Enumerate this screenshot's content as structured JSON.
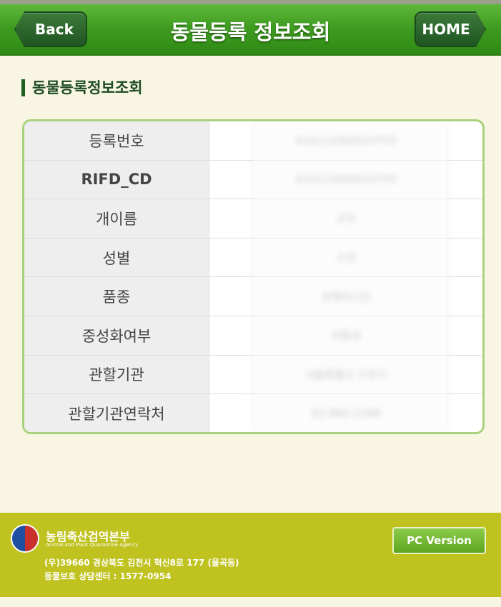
{
  "header": {
    "title": "동물등록 정보조회",
    "back_label": "Back",
    "home_label": "HOME"
  },
  "section": {
    "title": "동물등록정보조회"
  },
  "info_rows": [
    {
      "label": "등록번호",
      "value": "410111000010755"
    },
    {
      "label": "RIFD_CD",
      "value": "410111000010755"
    },
    {
      "label": "개이름",
      "value": "코코"
    },
    {
      "label": "성별",
      "value": "수컷"
    },
    {
      "label": "품종",
      "value": "포메라니안"
    },
    {
      "label": "중성화여부",
      "value": "미중성"
    },
    {
      "label": "관할기관",
      "value": "서울특별시 구로구"
    },
    {
      "label": "관할기관연락처",
      "value": "02-860-2268"
    }
  ],
  "footer": {
    "org_name": "농림축산검역본부",
    "org_name_en": "Animal and Plant Quarantine Agency",
    "address": "(우)39660 경상북도 김천시 혁신8로 177 (율곡동)",
    "hotline": "동물보호 상담센터 : 1577-0954",
    "pc_version_label": "PC Version"
  },
  "colors": {
    "header_green": "#3d9a1f",
    "footer_olive": "#bfc21f",
    "background": "#f8f6e2",
    "table_border": "#a8d27e"
  }
}
